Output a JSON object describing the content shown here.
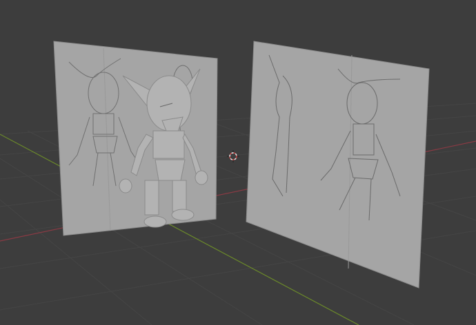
{
  "viewport": {
    "mode": "3d-viewport",
    "background_color": "#3d3d3d",
    "grid_color": "#4a4a4a",
    "x_axis_color": "#8a3a44",
    "y_axis_color": "#6b8a2a",
    "plane_color": "#a7a7a7",
    "model_color": "#b5b5b5",
    "sketch_line_color": "#6e6e6e"
  },
  "objects": [
    {
      "name": "front-reference-plane"
    },
    {
      "name": "side-reference-plane"
    },
    {
      "name": "goblin-model"
    }
  ],
  "cursor": {
    "icon": "3d-cursor-icon"
  }
}
